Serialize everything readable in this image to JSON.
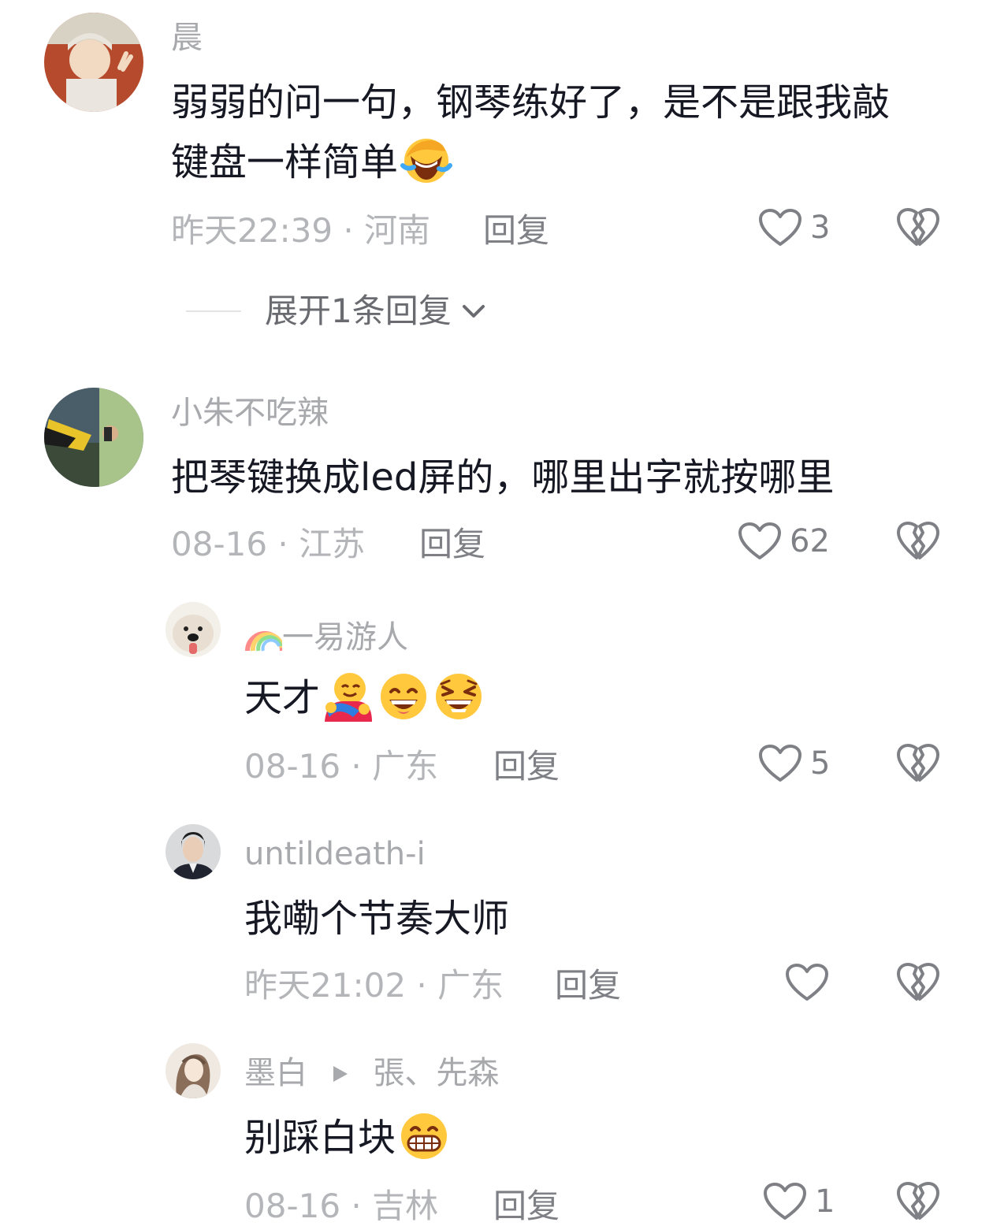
{
  "comments": [
    {
      "username": "晨",
      "text": "弱弱的问一句，钢琴练好了，是不是跟我敲",
      "text_line2": "键盘一样简单",
      "emoji_icons": [
        "rofl-emoji"
      ],
      "time": "昨天22:39",
      "location": "河南",
      "reply_label": "回复",
      "like_count": "3",
      "expand_label": "展开1条回复"
    },
    {
      "username": "小朱不吃辣",
      "text": "把琴键换成led屏的，哪里出字就按哪里",
      "time": "08-16",
      "location": "江苏",
      "reply_label": "回复",
      "like_count": "62",
      "replies": [
        {
          "username": "一易游人",
          "username_prefix_icon": "rainbow-emoji",
          "text": "天才",
          "emoji_icons": [
            "hug-emoji",
            "grin-emoji",
            "laugh-squint-emoji"
          ],
          "time": "08-16",
          "location": "广东",
          "reply_label": "回复",
          "like_count": "5"
        },
        {
          "username": "untildeath-i",
          "text": "我嘞个节奏大师",
          "time": "昨天21:02",
          "location": "广东",
          "reply_label": "回复",
          "like_count": ""
        },
        {
          "username": "墨白",
          "reply_to": "張、先森",
          "text": "别踩白块",
          "emoji_icons": [
            "big-grin-emoji"
          ],
          "time": "08-16",
          "location": "吉林",
          "reply_label": "回复",
          "like_count": "1"
        }
      ]
    }
  ],
  "separator": " · ",
  "colors": {
    "text": "#161823",
    "username": "#a8a9ad",
    "meta": "#b4b5b8",
    "action": "#7f8085"
  }
}
